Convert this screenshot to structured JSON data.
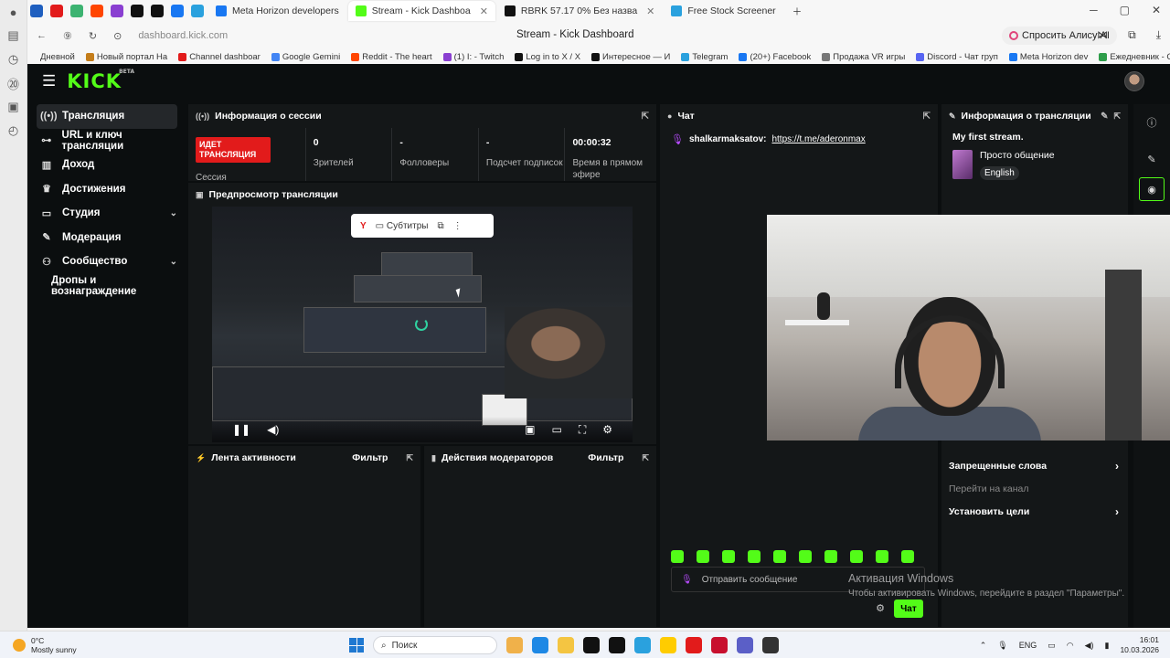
{
  "browser": {
    "tabs": [
      {
        "label": "Meta Horizon developers",
        "active": false
      },
      {
        "label": "Stream - Kick Dashboa",
        "active": true
      },
      {
        "label": "RBRK 57.17 0% Без назва",
        "active": false
      },
      {
        "label": "Free Stock Screener",
        "active": false
      }
    ],
    "url": "dashboard.kick.com",
    "page_title": "Stream - Kick Dashboard",
    "alice_button": "Спросить Алису AI",
    "bookmarks": [
      "Дневной",
      "Новый портал На",
      "Channel dashboar",
      "Google Gemini",
      "Reddit - The heart",
      "(1) I: - Twitch",
      "Log in to X / X",
      "Интересное — И",
      "Telegram",
      "(20+) Facebook",
      "Продажа VR игры",
      "Discord - Чат груп",
      "Meta Horizon dev",
      "Ежедневник - Go"
    ]
  },
  "app": {
    "logo": "KICK",
    "logo_badge": "BETA"
  },
  "sidebar": {
    "items": [
      {
        "label": "Трансляция",
        "icon": "broadcast-icon",
        "glyph": "((•))",
        "active": true,
        "chevron": false
      },
      {
        "label": "URL и ключ трансляции",
        "icon": "link-icon",
        "glyph": "🔗",
        "active": false,
        "chevron": false
      },
      {
        "label": "Доход",
        "icon": "chart-icon",
        "glyph": "▮",
        "active": false,
        "chevron": false
      },
      {
        "label": "Достижения",
        "icon": "trophy-icon",
        "glyph": "🏆",
        "active": false,
        "chevron": false
      },
      {
        "label": "Студия",
        "icon": "studio-icon",
        "glyph": "▭",
        "active": false,
        "chevron": true
      },
      {
        "label": "Модерация",
        "icon": "wrench-icon",
        "glyph": "🔧",
        "active": false,
        "chevron": false
      },
      {
        "label": "Сообщество",
        "icon": "community-icon",
        "glyph": "👥",
        "active": false,
        "chevron": true
      },
      {
        "label": "Дропы и вознаграждение",
        "icon": "",
        "glyph": "",
        "active": false,
        "chevron": false
      }
    ]
  },
  "session": {
    "title": "Информация о сессии",
    "live_badge": "ИДЕТ ТРАНСЛЯЦИЯ",
    "session_label": "Сессия",
    "stats": [
      {
        "value": "0",
        "label": "Зрителей"
      },
      {
        "value": "-",
        "label": "Фолловеры"
      },
      {
        "value": "-",
        "label": "Подсчет подписок"
      },
      {
        "value": "00:00:32",
        "label": "Время в прямом эфире"
      }
    ]
  },
  "preview": {
    "title": "Предпросмотр трансляции",
    "subtitles_label": "Субтитры"
  },
  "activity": {
    "title": "Лента активности",
    "filter": "Фильтр"
  },
  "mod_actions": {
    "title": "Действия модераторов",
    "filter": "Фильтр"
  },
  "chat": {
    "title": "Чат",
    "messages": [
      {
        "user": "shalkarmaksatov:",
        "text": "https://t.me/aderonmax"
      }
    ],
    "input_placeholder": "Отправить сообщение",
    "send_label": "Чат"
  },
  "stream_info": {
    "title": "Информация о трансляции",
    "stream_title": "My first stream.",
    "category": "Просто общение",
    "language": "English",
    "items": [
      {
        "label": "Запрещенные слова",
        "arrow": true,
        "muted": false
      },
      {
        "label": "Перейти на канал",
        "arrow": false,
        "muted": true
      },
      {
        "label": "Установить цели",
        "arrow": true,
        "muted": false
      }
    ]
  },
  "watermark": {
    "line1": "Активация Windows",
    "line2": "Чтобы активировать Windows, перейдите в раздел \"Параметры\"."
  },
  "taskbar": {
    "weather_temp": "0°C",
    "weather_text": "Mostly sunny",
    "search_placeholder": "Поиск",
    "lang": "ENG",
    "time": "16:01",
    "date": "10.03.2026"
  },
  "colors": {
    "kick_green": "#53fc18",
    "live_red": "#e21b1b",
    "app_bg": "#0b0e0f",
    "panel_bg": "#141718"
  }
}
